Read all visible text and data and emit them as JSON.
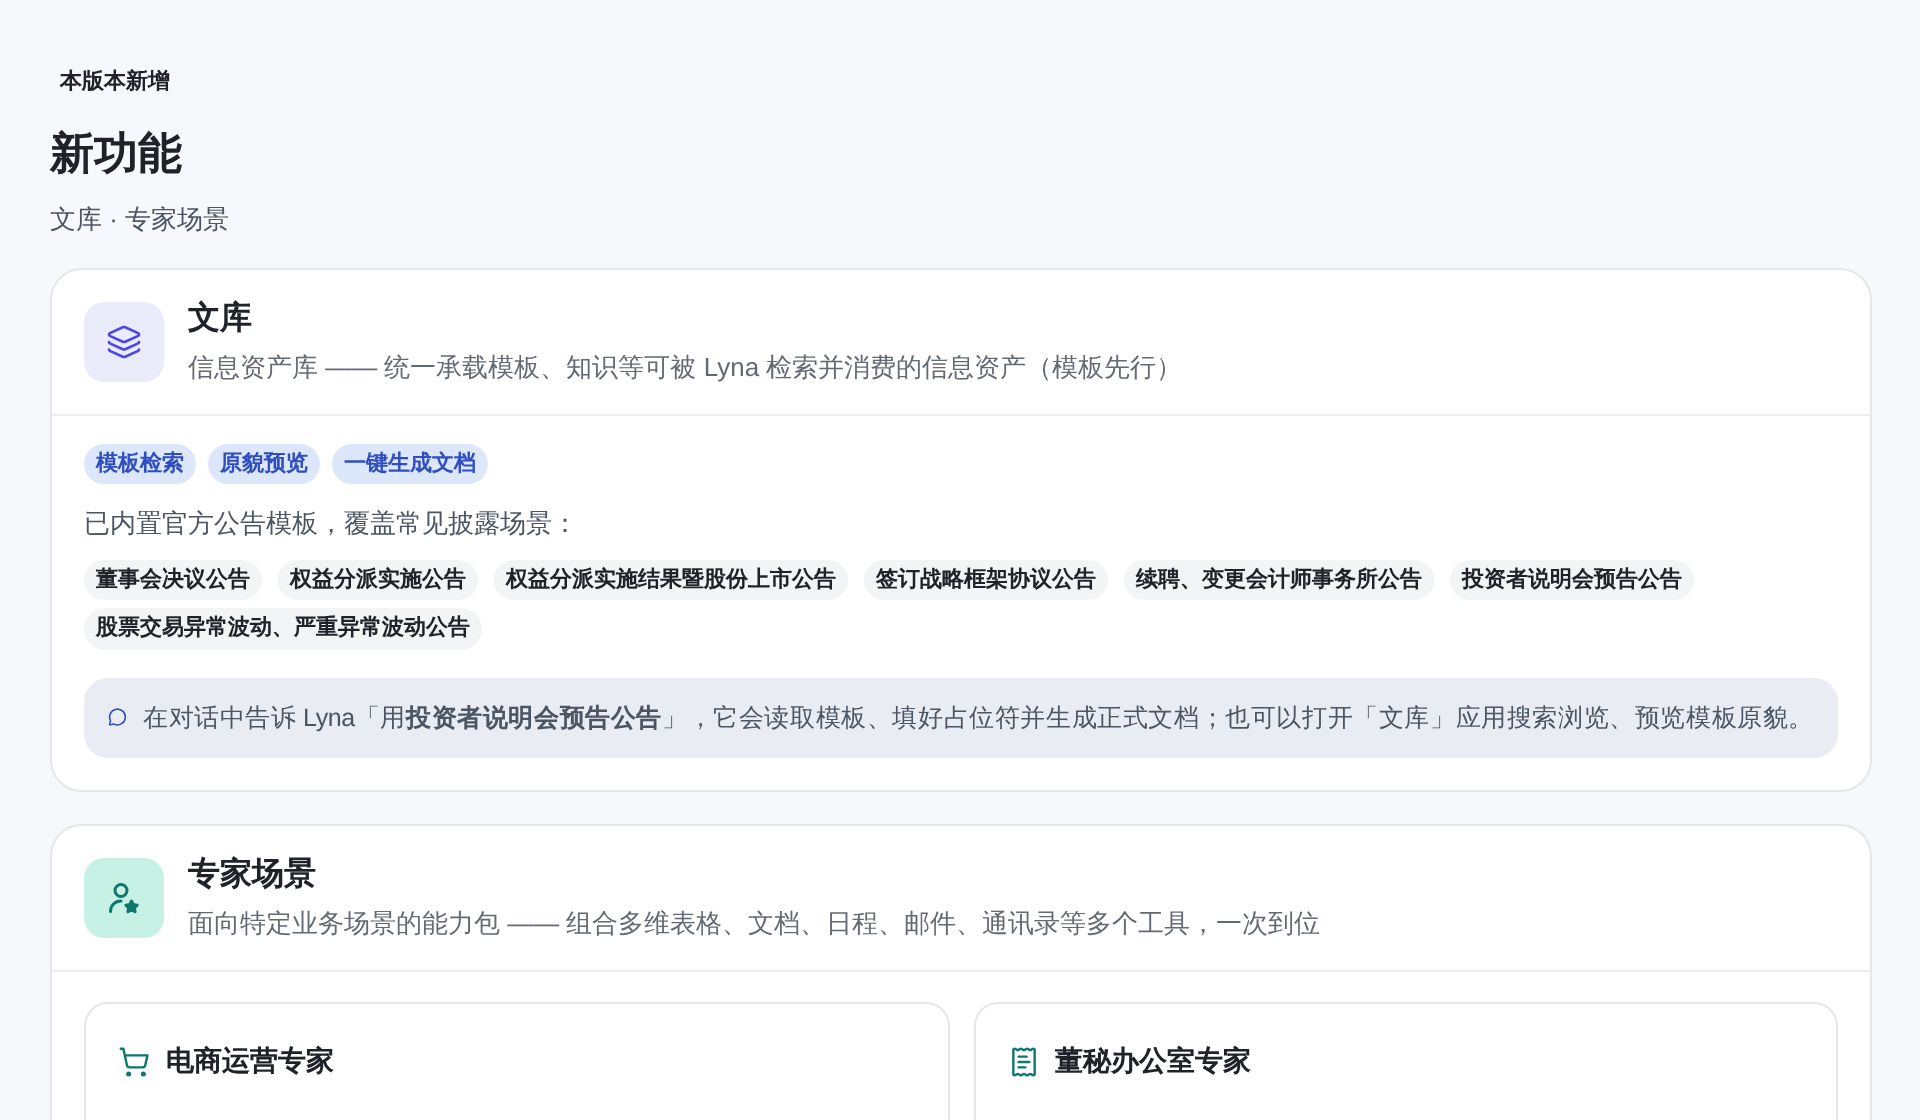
{
  "badge": "本版本新增",
  "title": "新功能",
  "subtitle": "文库 · 专家场景",
  "library": {
    "title": "文库",
    "description": "信息资产库 —— 统一承载模板、知识等可被 Lyna 检索并消费的信息资产（模板先行）",
    "features": [
      "模板检索",
      "原貌预览",
      "一键生成文档"
    ],
    "intro": "已内置官方公告模板，覆盖常见披露场景：",
    "templates": [
      "董事会决议公告",
      "权益分派实施公告",
      "权益分派实施结果暨股份上市公告",
      "签订战略框架协议公告",
      "续聘、变更会计师事务所公告",
      "投资者说明会预告公告",
      "股票交易异常波动、严重异常波动公告"
    ],
    "tip": "在对话中告诉 Lyna「用**投资者说明会预告公告**」，它会读取模板、填好占位符并生成正式文档；也可以打开「文库」应用搜索浏览、预览模板原貌。"
  },
  "experts": {
    "title": "专家场景",
    "description": "面向特定业务场景的能力包 —— 组合多维表格、文档、日程、邮件、通讯录等多个工具，一次到位",
    "packs": [
      {
        "kind": "cart",
        "title": "电商运营专家"
      },
      {
        "kind": "document",
        "title": "董秘办公室专家"
      }
    ]
  }
}
